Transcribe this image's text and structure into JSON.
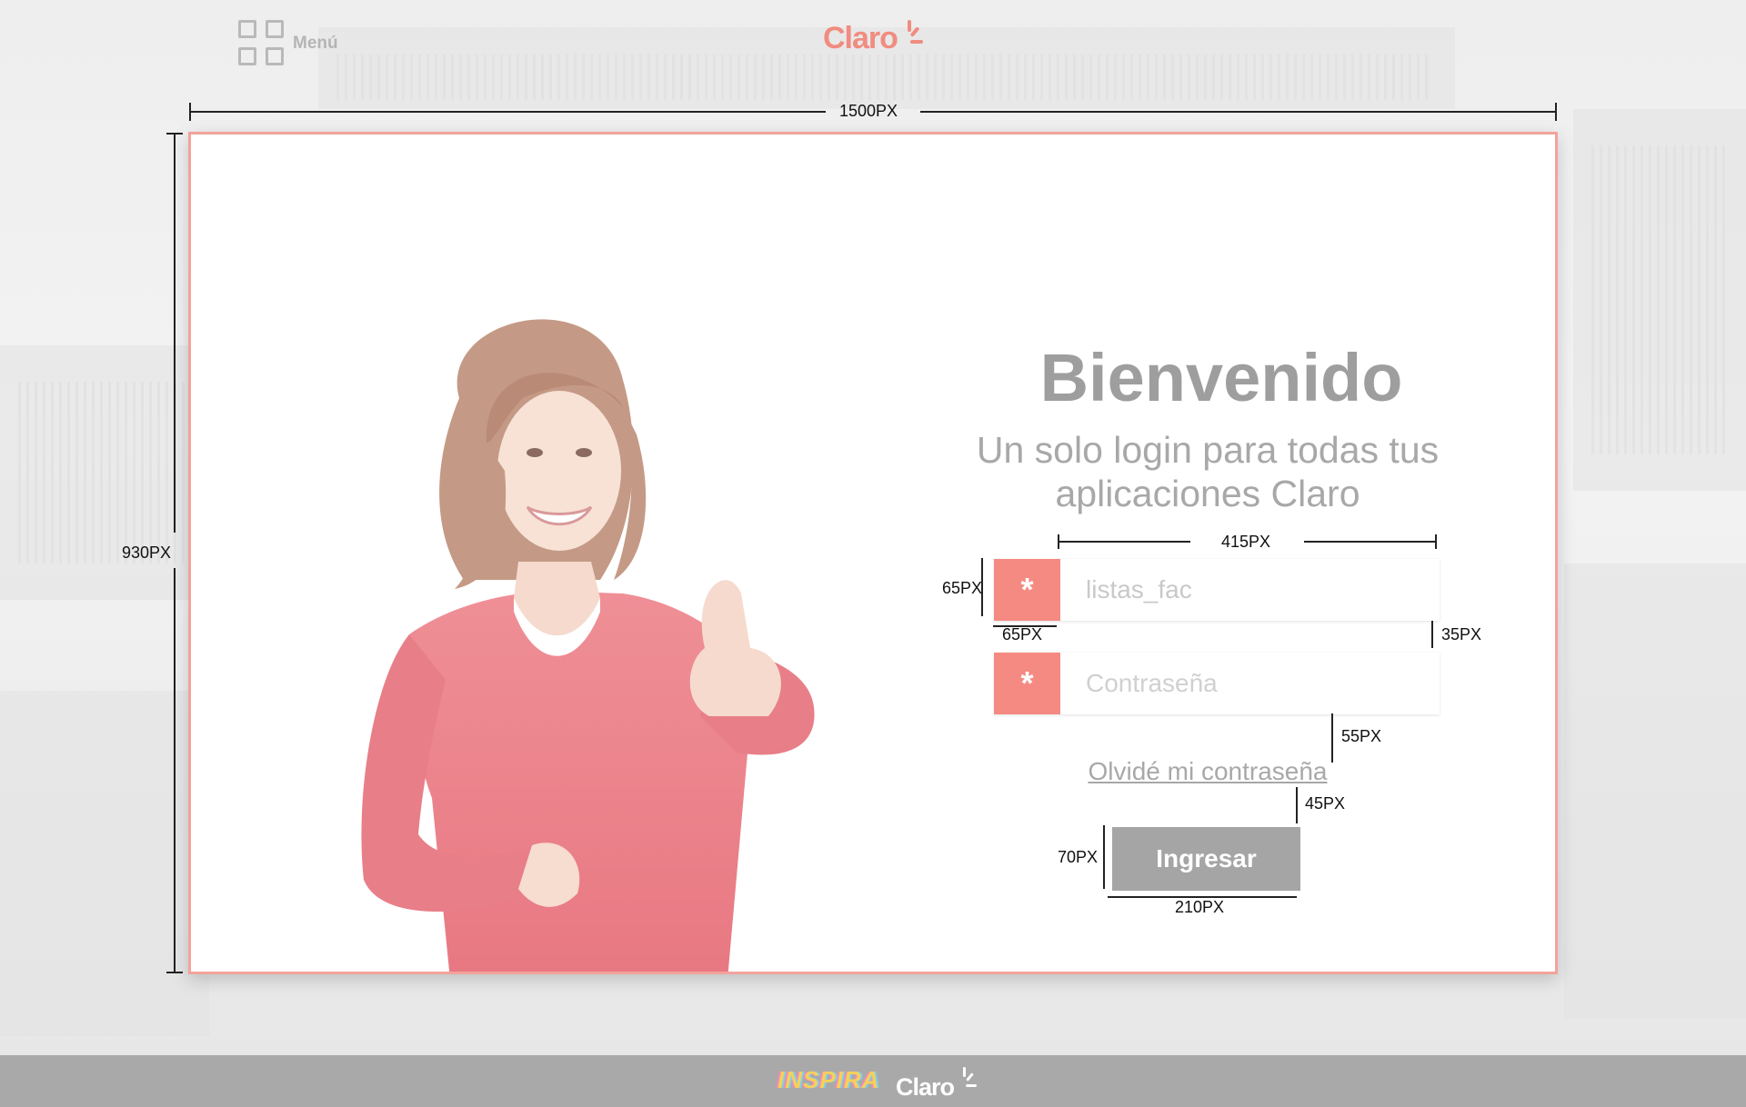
{
  "header": {
    "menu_label": "Menú",
    "logo_text": "Claro"
  },
  "dimensions": {
    "card_width": "1500PX",
    "card_height": "930PX",
    "field_width": "415PX",
    "field_height": "65PX",
    "icon_width": "65PX",
    "field_gap": "35PX",
    "forgot_gap": "55PX",
    "button_gap": "45PX",
    "button_height": "70PX",
    "button_width": "210PX"
  },
  "login": {
    "title": "Bienvenido",
    "subtitle": "Un solo login para todas tus aplicaciones Claro",
    "username_value": "listas_fac",
    "password_placeholder": "Contraseña",
    "field_icon": "*",
    "forgot_link": "Olvidé mi contraseña",
    "submit_label": "Ingresar"
  },
  "footer": {
    "inspira_logo": "INSPIRA",
    "claro_logo": "Claro"
  },
  "colors": {
    "accent": "#f58a82",
    "card_border": "#f2a39b",
    "button": "#a5a5a5",
    "footer": "#a9a9a9"
  }
}
